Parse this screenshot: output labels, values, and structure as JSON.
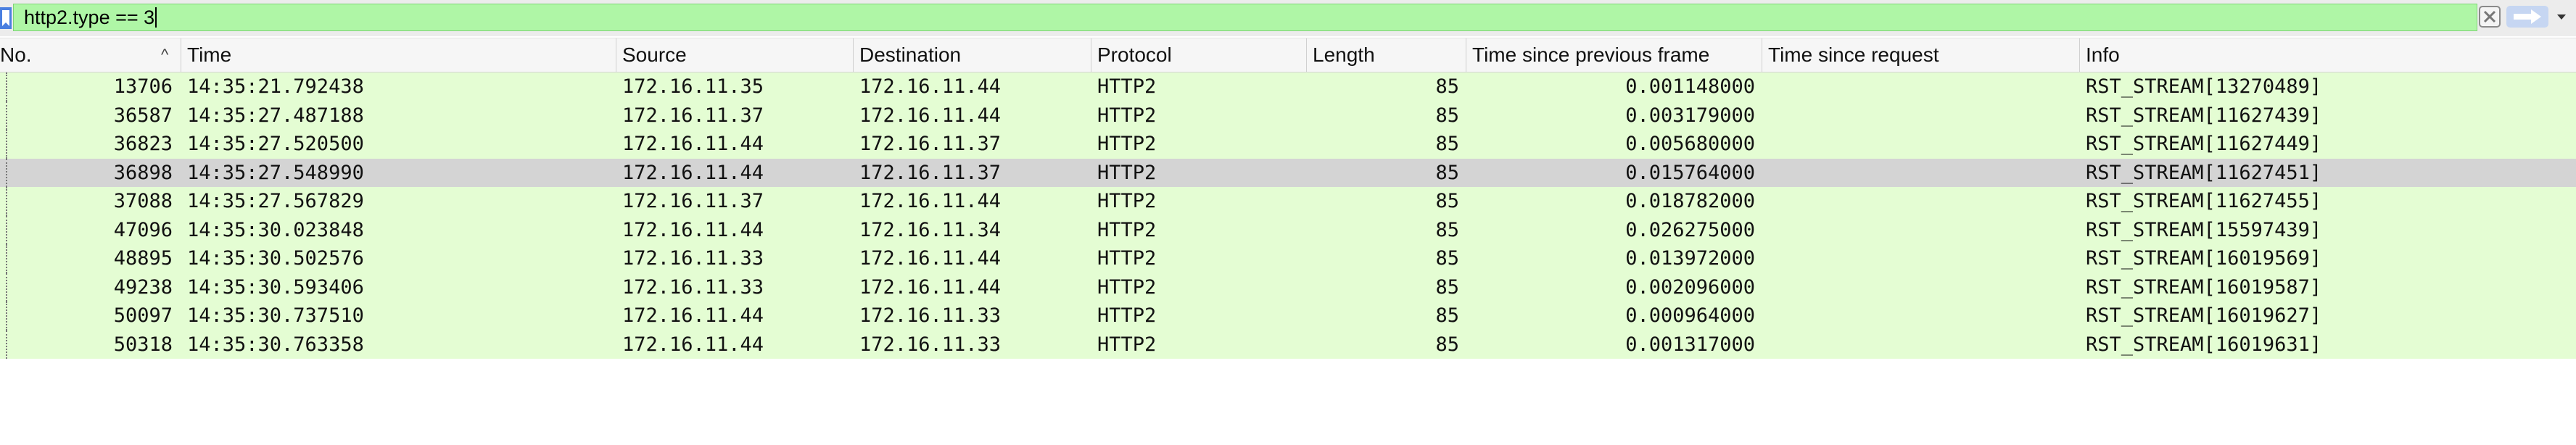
{
  "filter": {
    "value": "http2.type == 3",
    "icons": {
      "bookmark": "bookmark-icon",
      "clear": "clear-icon",
      "apply": "arrow-right-icon",
      "history": "chevron-down-icon"
    }
  },
  "columns": [
    {
      "key": "no",
      "label": "No."
    },
    {
      "key": "time",
      "label": "Time"
    },
    {
      "key": "source",
      "label": "Source"
    },
    {
      "key": "destination",
      "label": "Destination"
    },
    {
      "key": "protocol",
      "label": "Protocol"
    },
    {
      "key": "length",
      "label": "Length"
    },
    {
      "key": "delta",
      "label": "Time since previous frame"
    },
    {
      "key": "since_request",
      "label": "Time since request"
    },
    {
      "key": "info",
      "label": "Info"
    }
  ],
  "sort_indicator": "^",
  "colors": {
    "filter_valid": "#aff6a6",
    "row_bg": "#e4fdd3",
    "row_selected": "#d4d4d4"
  },
  "selected_index": 3,
  "rows": [
    {
      "no": "13706",
      "time": "14:35:21.792438",
      "source": "172.16.11.35",
      "destination": "172.16.11.44",
      "protocol": "HTTP2",
      "length": "85",
      "delta": "0.001148000",
      "since_request": "",
      "info": "RST_STREAM[13270489]"
    },
    {
      "no": "36587",
      "time": "14:35:27.487188",
      "source": "172.16.11.37",
      "destination": "172.16.11.44",
      "protocol": "HTTP2",
      "length": "85",
      "delta": "0.003179000",
      "since_request": "",
      "info": "RST_STREAM[11627439]"
    },
    {
      "no": "36823",
      "time": "14:35:27.520500",
      "source": "172.16.11.44",
      "destination": "172.16.11.37",
      "protocol": "HTTP2",
      "length": "85",
      "delta": "0.005680000",
      "since_request": "",
      "info": "RST_STREAM[11627449]"
    },
    {
      "no": "36898",
      "time": "14:35:27.548990",
      "source": "172.16.11.44",
      "destination": "172.16.11.37",
      "protocol": "HTTP2",
      "length": "85",
      "delta": "0.015764000",
      "since_request": "",
      "info": "RST_STREAM[11627451]"
    },
    {
      "no": "37088",
      "time": "14:35:27.567829",
      "source": "172.16.11.37",
      "destination": "172.16.11.44",
      "protocol": "HTTP2",
      "length": "85",
      "delta": "0.018782000",
      "since_request": "",
      "info": "RST_STREAM[11627455]"
    },
    {
      "no": "47096",
      "time": "14:35:30.023848",
      "source": "172.16.11.44",
      "destination": "172.16.11.34",
      "protocol": "HTTP2",
      "length": "85",
      "delta": "0.026275000",
      "since_request": "",
      "info": "RST_STREAM[15597439]"
    },
    {
      "no": "48895",
      "time": "14:35:30.502576",
      "source": "172.16.11.33",
      "destination": "172.16.11.44",
      "protocol": "HTTP2",
      "length": "85",
      "delta": "0.013972000",
      "since_request": "",
      "info": "RST_STREAM[16019569]"
    },
    {
      "no": "49238",
      "time": "14:35:30.593406",
      "source": "172.16.11.33",
      "destination": "172.16.11.44",
      "protocol": "HTTP2",
      "length": "85",
      "delta": "0.002096000",
      "since_request": "",
      "info": "RST_STREAM[16019587]"
    },
    {
      "no": "50097",
      "time": "14:35:30.737510",
      "source": "172.16.11.44",
      "destination": "172.16.11.33",
      "protocol": "HTTP2",
      "length": "85",
      "delta": "0.000964000",
      "since_request": "",
      "info": "RST_STREAM[16019627]"
    },
    {
      "no": "50318",
      "time": "14:35:30.763358",
      "source": "172.16.11.44",
      "destination": "172.16.11.33",
      "protocol": "HTTP2",
      "length": "85",
      "delta": "0.001317000",
      "since_request": "",
      "info": "RST_STREAM[16019631]"
    }
  ]
}
